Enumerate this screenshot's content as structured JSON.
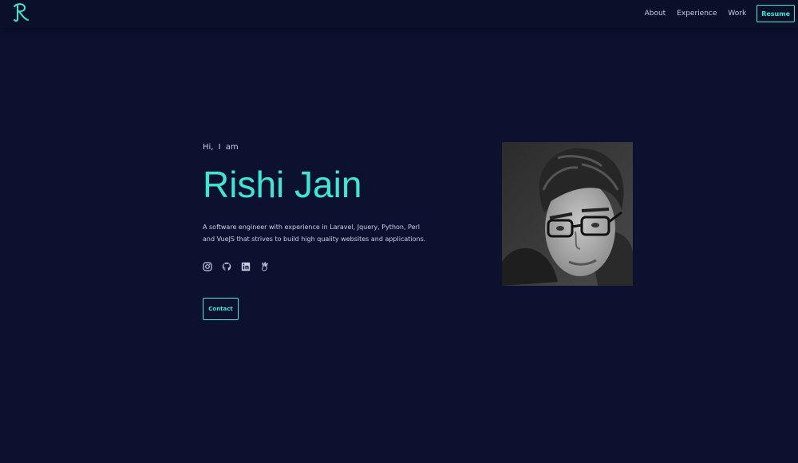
{
  "nav": {
    "logo_letter": "R",
    "links": [
      "About",
      "Experience",
      "Work"
    ],
    "resume_label": "Resume"
  },
  "hero": {
    "greeting": "Hi, I am",
    "name": "Rishi Jain",
    "description": "A software engineer with experience in Laravel, Jquery, Python, Perl and VueJS that strives to build high quality websites and applications.",
    "contact_label": "Contact"
  },
  "socials": [
    "instagram-icon",
    "github-icon",
    "linkedin-icon",
    "angellist-icon"
  ],
  "colors": {
    "background": "#0c1130",
    "navbar": "#0b1029",
    "accent": "#3ee6d3",
    "text": "#c9cfe4"
  }
}
